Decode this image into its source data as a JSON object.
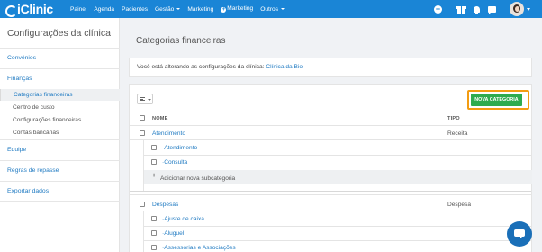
{
  "topbar": {
    "brand": "iClinic",
    "nav": [
      "Painel",
      "Agenda",
      "Pacientes",
      "Gestão",
      "Marketing",
      "Marketing",
      "Outros"
    ]
  },
  "sidebar": {
    "title": "Configurações da clínica",
    "sections": [
      "Convênios",
      "Finanças",
      "Equipe",
      "Regras de repasse",
      "Exportar dados"
    ],
    "finance_items": [
      "Categorias financeiras",
      "Centro de custo",
      "Configurações financeiras",
      "Contas bancárias"
    ]
  },
  "main": {
    "title": "Categorias financeiras",
    "info_prefix": "Você está alterando as configurações da clínica:",
    "clinic_name": "Clínica da Bio",
    "new_button": "NOVA CATEGORIA",
    "columns": [
      "NOME",
      "TIPO"
    ],
    "groups": [
      {
        "name": "Atendimento",
        "type": "Receita",
        "subs": [
          "Atendimento",
          "Consulta"
        ],
        "add_label": "Adicionar nova subcategoria"
      },
      {
        "name": "Despesas",
        "type": "Despesa",
        "subs": [
          "Ajuste de caixa",
          "Aluguel",
          "Assessorias e Associações"
        ]
      }
    ]
  },
  "colors": {
    "topbar": "#1a85d6",
    "link": "#1f7ac2",
    "button": "#2eab4e",
    "highlight": "#f39c12",
    "chat": "#1a6fb8"
  }
}
